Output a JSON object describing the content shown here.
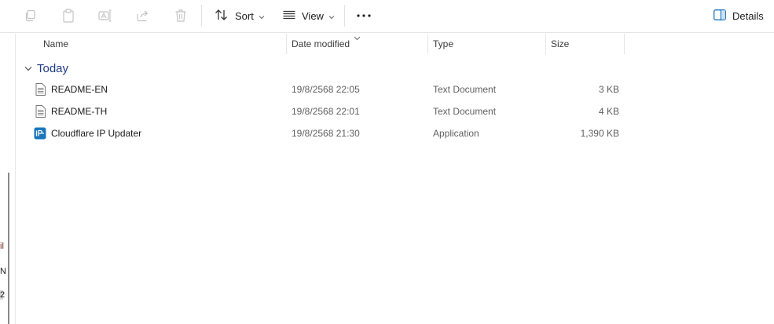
{
  "toolbar": {
    "sort_label": "Sort",
    "view_label": "View",
    "details_label": "Details"
  },
  "columns": {
    "name": "Name",
    "date_modified": "Date modified",
    "type": "Type",
    "size": "Size"
  },
  "group": {
    "label": "Today"
  },
  "files": [
    {
      "name": "README-EN",
      "date": "19/8/2568 22:05",
      "type": "Text Document",
      "size": "3 KB",
      "icon": "text-document-icon"
    },
    {
      "name": "README-TH",
      "date": "19/8/2568 22:01",
      "type": "Text Document",
      "size": "4 KB",
      "icon": "text-document-icon"
    },
    {
      "name": "Cloudflare IP Updater",
      "date": "19/8/2568 21:30",
      "type": "Application",
      "size": "1,390 KB",
      "icon": "app-icon"
    }
  ],
  "nav_fragments": [
    "il",
    "N",
    "2"
  ],
  "colors": {
    "accent": "#1f3c88",
    "app_icon": "#1b75bb",
    "disabled_icon": "#b9b9b9"
  }
}
